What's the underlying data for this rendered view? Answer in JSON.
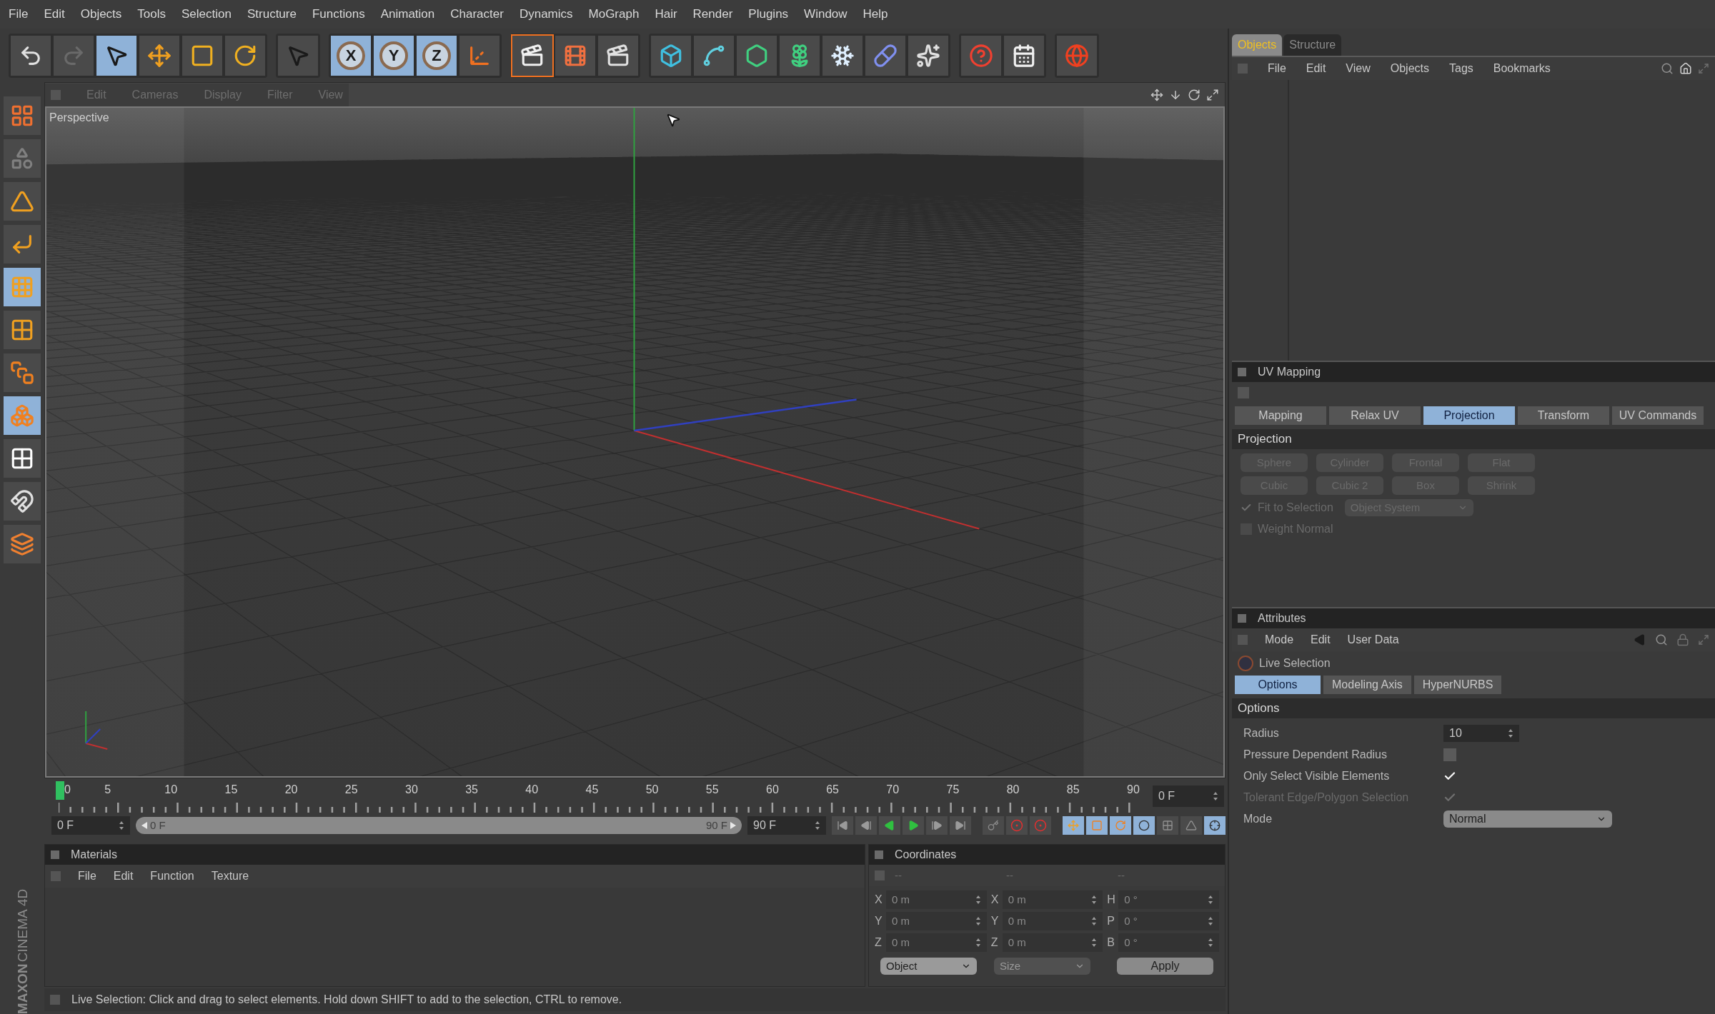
{
  "menu_bar": [
    "File",
    "Edit",
    "Objects",
    "Tools",
    "Selection",
    "Structure",
    "Functions",
    "Animation",
    "Character",
    "Dynamics",
    "MoGraph",
    "Hair",
    "Render",
    "Plugins",
    "Window",
    "Help"
  ],
  "toolbar_groups": [
    [
      {
        "kind": "undo",
        "selected": false
      },
      {
        "kind": "redo",
        "selected": false
      },
      {
        "kind": "select",
        "selected": true
      },
      {
        "kind": "move",
        "selected": false
      },
      {
        "kind": "scale",
        "selected": false
      },
      {
        "kind": "rotate",
        "selected": false
      }
    ],
    [
      {
        "kind": "pointer",
        "selected": false
      }
    ],
    [
      {
        "kind": "axis",
        "label": "X",
        "selected": true
      },
      {
        "kind": "axis",
        "label": "Y",
        "selected": true
      },
      {
        "kind": "axis",
        "label": "Z",
        "selected": true
      },
      {
        "kind": "coords",
        "selected": false
      }
    ],
    [
      {
        "kind": "render-view",
        "selected": false
      },
      {
        "kind": "render-picture",
        "selected": false
      },
      {
        "kind": "render-settings",
        "selected": false
      }
    ],
    [
      {
        "kind": "cube",
        "selected": false
      },
      {
        "kind": "spline",
        "selected": false
      },
      {
        "kind": "nurbs",
        "selected": false
      },
      {
        "kind": "array",
        "selected": false
      },
      {
        "kind": "deformer",
        "selected": false
      },
      {
        "kind": "scene",
        "selected": false
      },
      {
        "kind": "particles",
        "selected": false
      }
    ],
    [
      {
        "kind": "help",
        "selected": false
      },
      {
        "kind": "layout",
        "selected": false
      }
    ],
    [
      {
        "kind": "browser",
        "selected": false
      }
    ]
  ],
  "left_tools": [
    {
      "kind": "layout",
      "selected": false
    },
    {
      "kind": "model",
      "selected": false
    },
    {
      "kind": "texture",
      "selected": false
    },
    {
      "kind": "workplane",
      "selected": false
    },
    {
      "kind": "points",
      "selected": true
    },
    {
      "kind": "edges",
      "selected": false
    },
    {
      "kind": "polygons",
      "selected": false
    },
    {
      "kind": "object",
      "selected": true
    },
    {
      "kind": "checker",
      "selected": false
    },
    {
      "kind": "snap",
      "selected": false
    },
    {
      "kind": "sculpt",
      "selected": false
    }
  ],
  "logo": {
    "brand": "MAXON",
    "product": "CINEMA 4D"
  },
  "viewport": {
    "menu": [
      "Edit",
      "Cameras",
      "Display",
      "Filter",
      "View"
    ],
    "camera_label": "Perspective"
  },
  "timeline": {
    "ruler_labels": [
      "0",
      "5",
      "10",
      "15",
      "20",
      "25",
      "30",
      "35",
      "40",
      "45",
      "50",
      "55",
      "60",
      "65",
      "70",
      "75",
      "80",
      "85",
      "90"
    ],
    "current_frame": "0 F",
    "start_field": "0 F",
    "range_slider": {
      "start": "0 F",
      "end": "90 F",
      "level": 1
    },
    "end_field": "90 F",
    "mode_buttons": [
      {
        "selected": true
      },
      {
        "selected": true
      },
      {
        "selected": true
      },
      {
        "selected": true
      },
      {
        "selected": false
      },
      {
        "selected": false
      },
      {
        "selected": true
      }
    ]
  },
  "materials": {
    "title": "Materials",
    "menu": [
      "File",
      "Edit",
      "Function",
      "Texture"
    ]
  },
  "coordinates": {
    "title": "Coordinates",
    "column_headers": [
      "--",
      "--",
      "--"
    ],
    "rows": [
      [
        {
          "axis": "X",
          "value": "0 m"
        },
        {
          "axis": "X",
          "value": "0 m"
        },
        {
          "axis": "H",
          "value": "0 °"
        }
      ],
      [
        {
          "axis": "Y",
          "value": "0 m"
        },
        {
          "axis": "Y",
          "value": "0 m"
        },
        {
          "axis": "P",
          "value": "0 °"
        }
      ],
      [
        {
          "axis": "Z",
          "value": "0 m"
        },
        {
          "axis": "Z",
          "value": "0 m"
        },
        {
          "axis": "B",
          "value": "0 °"
        }
      ]
    ],
    "dropdowns": [
      {
        "value": "Object",
        "disabled": false
      },
      {
        "value": "Size",
        "disabled": true
      }
    ],
    "apply": "Apply"
  },
  "status_bar": "Live Selection: Click and drag to select elements. Hold down SHIFT to add to the selection, CTRL to remove.",
  "objects_manager": {
    "tabs": [
      {
        "label": "Objects",
        "selected": true
      },
      {
        "label": "Structure",
        "selected": false
      }
    ],
    "menu": [
      "File",
      "Edit",
      "View",
      "Objects",
      "Tags",
      "Bookmarks"
    ]
  },
  "uv_mapping": {
    "title": "UV Mapping",
    "tabs": [
      {
        "label": "Mapping",
        "selected": false
      },
      {
        "label": "Relax UV",
        "selected": false
      },
      {
        "label": "Projection",
        "selected": true
      },
      {
        "label": "Transform",
        "selected": false
      },
      {
        "label": "UV Commands",
        "selected": false
      }
    ],
    "section": "Projection",
    "buttons": [
      [
        {
          "label": "Sphere",
          "disabled": true
        },
        {
          "label": "Cylinder",
          "disabled": true
        },
        {
          "label": "Frontal",
          "disabled": true
        },
        {
          "label": "Flat",
          "disabled": true
        }
      ],
      [
        {
          "label": "Cubic",
          "disabled": true
        },
        {
          "label": "Cubic 2",
          "disabled": true
        },
        {
          "label": "Box",
          "disabled": true
        },
        {
          "label": "Shrink",
          "disabled": true
        }
      ]
    ],
    "options": [
      {
        "label": "Fit to Selection",
        "checked": true,
        "disabled": true,
        "dropdown": "Object System"
      },
      {
        "label": "Weight Normal",
        "checked": false,
        "disabled": true
      }
    ]
  },
  "attributes": {
    "title": "Attributes",
    "menu": [
      "Mode",
      "Edit",
      "User Data"
    ],
    "tool_name": "Live Selection",
    "tabs": [
      {
        "label": "Options",
        "selected": true
      },
      {
        "label": "Modeling Axis",
        "selected": false
      },
      {
        "label": "HyperNURBS",
        "selected": false
      }
    ],
    "section": "Options",
    "fields": [
      {
        "kind": "number",
        "label": "Radius",
        "value": "10",
        "disabled": false
      },
      {
        "kind": "checkbox",
        "label": "Pressure Dependent Radius",
        "checked": false,
        "disabled": false
      },
      {
        "kind": "checkbox",
        "label": "Only Select Visible Elements",
        "checked": true,
        "disabled": false
      },
      {
        "kind": "checkbox",
        "label": "Tolerant Edge/Polygon Selection",
        "checked": true,
        "disabled": true
      },
      {
        "kind": "dropdown",
        "label": "Mode",
        "value": "Normal",
        "disabled": false
      }
    ]
  }
}
